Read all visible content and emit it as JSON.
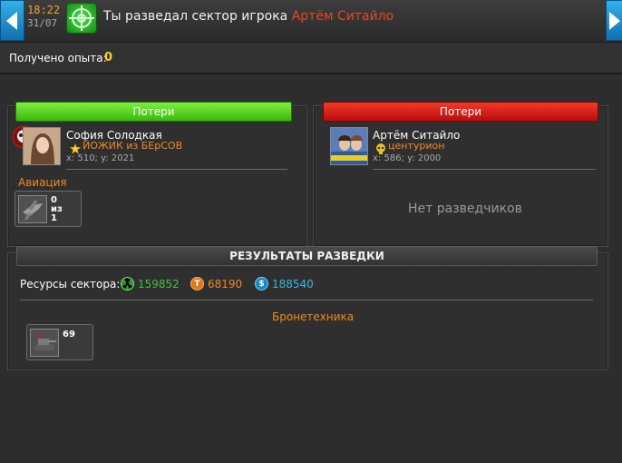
{
  "header": {
    "time": "18:22",
    "date": "31/07",
    "title_prefix": "Ты разведал сектор игрока",
    "title_player": "Артём Ситайло"
  },
  "xp": {
    "label": "Получено опыта:",
    "value": "0"
  },
  "left_panel": {
    "banner": "Потери",
    "player_name": "София Солодкая",
    "player_clan": "ЙОЖИК из БЕрСОВ",
    "coords": "x: 510; y: 2021",
    "category": "Авиация",
    "unit_count_line1": "0",
    "unit_count_line2": "из",
    "unit_count_line3": "1"
  },
  "right_panel": {
    "banner": "Потери",
    "player_name": "Артём Ситайло",
    "player_clan": "центурион",
    "coords": "x: 586; y: 2000",
    "empty_text": "Нет разведчиков"
  },
  "results": {
    "banner": "РЕЗУЛЬТАТЫ РАЗВЕДКИ",
    "resources_label": "Ресурсы сектора:",
    "resource_green": "159852",
    "resource_orange": "68190",
    "resource_blue": "188540",
    "category": "Бронетехника",
    "unit_count": "69"
  },
  "colors": {
    "accent_orange": "#f08a1e",
    "enemy_red": "#e5472a",
    "green_resource": "#3fc43f",
    "orange_resource": "#f08a1e",
    "blue_resource": "#34b8e6"
  },
  "icons": {
    "left_nav": "arrow-left-icon",
    "right_nav": "arrow-right-icon",
    "radar": "radar-icon",
    "rank_star": "star-icon",
    "rank_skull": "skull-icon",
    "resource_1": "radiation-icon",
    "resource_2": "titanium-icon",
    "resource_3": "dollar-icon"
  }
}
